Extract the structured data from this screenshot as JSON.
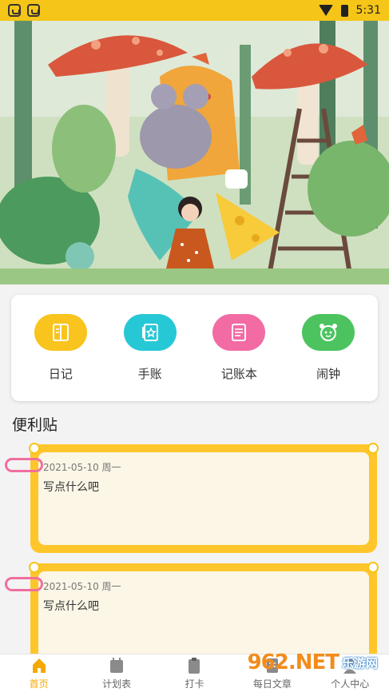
{
  "status_bar": {
    "time": "5:31"
  },
  "grid": [
    {
      "label": "日记",
      "color": "#f8c41d",
      "icon": "diary-icon"
    },
    {
      "label": "手账",
      "color": "#27c8d6",
      "icon": "handbook-icon"
    },
    {
      "label": "记账本",
      "color": "#f26ba3",
      "icon": "ledger-icon"
    },
    {
      "label": "闹钟",
      "color": "#4cc35f",
      "icon": "alarm-clock-icon"
    }
  ],
  "section": {
    "title": "便利贴"
  },
  "notes": [
    {
      "date": "2021-05-10 周一",
      "text": "写点什么吧"
    },
    {
      "date": "2021-05-10 周一",
      "text": "写点什么吧"
    }
  ],
  "tabs": [
    {
      "label": "首页",
      "icon": "home-icon",
      "active": true
    },
    {
      "label": "计划表",
      "icon": "calendar-icon",
      "active": false
    },
    {
      "label": "打卡",
      "icon": "clipboard-icon",
      "active": false
    },
    {
      "label": "每日文章",
      "icon": "article-icon",
      "active": false
    },
    {
      "label": "个人中心",
      "icon": "user-icon",
      "active": false
    }
  ],
  "watermark": {
    "big": "962.NET",
    "small": "乐游网"
  },
  "colors": {
    "accent": "#f5c518",
    "note_border": "#ffc62c",
    "tab_active": "#f5a800"
  }
}
